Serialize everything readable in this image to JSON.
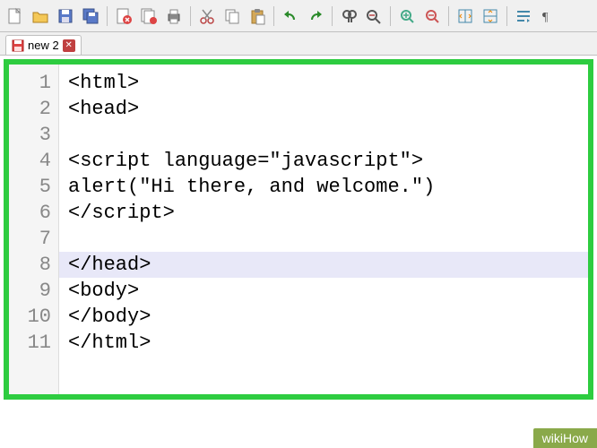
{
  "tab": {
    "label": "new 2",
    "dirty": true
  },
  "code": {
    "highlighted_line": 8,
    "lines": [
      "<html>",
      "<head>",
      "",
      "<script language=\"javascript\">",
      "alert(\"Hi there, and welcome.\")",
      "</script>",
      "",
      "</head>",
      "<body>",
      "</body>",
      "</html>"
    ]
  },
  "watermark": "wikiHow",
  "toolbar_icons": [
    "new-file-icon",
    "open-file-icon",
    "save-icon",
    "save-all-icon",
    "close-file-icon",
    "close-all-icon",
    "print-icon",
    "cut-icon",
    "copy-icon",
    "paste-icon",
    "undo-icon",
    "redo-icon",
    "find-icon",
    "replace-icon",
    "zoom-in-icon",
    "zoom-out-icon",
    "sync-vertical-icon",
    "sync-horizontal-icon",
    "word-wrap-icon",
    "show-chars-icon"
  ]
}
